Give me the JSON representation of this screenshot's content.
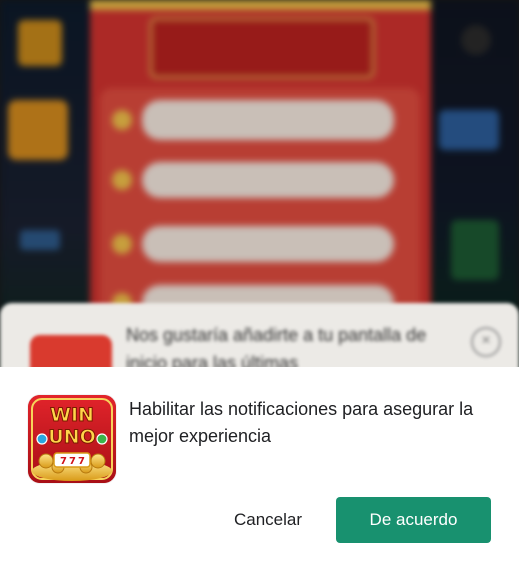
{
  "notification": {
    "message": "Habilitar las notificaciones para asegurar la mejor experiencia",
    "cancel_label": "Cancelar",
    "accept_label": "De acuerdo",
    "accept_color": "#18916f"
  },
  "app_icon": {
    "logo_line1": "WIN",
    "logo_line2": "UNO",
    "brand_color": "#c8161d"
  },
  "background_prompt": {
    "text": "Nos gustaría añadirte a tu pantalla de inicio para las últimas"
  },
  "icons": [
    "close-icon",
    "app-logo-icon"
  ]
}
